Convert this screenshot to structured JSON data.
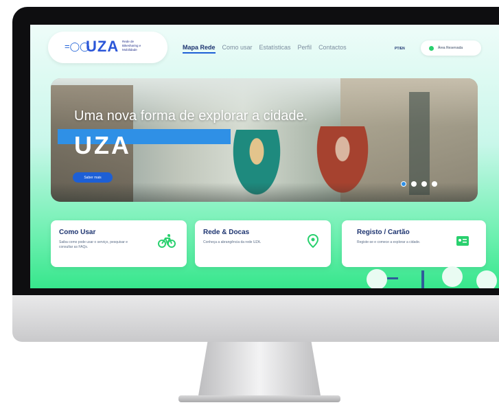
{
  "header": {
    "logo_text": "UZA",
    "logo_subtitle": "Rede de Bikesharing e Mobilidade",
    "nav": [
      {
        "label": "Mapa Rede",
        "active": true
      },
      {
        "label": "Como usar",
        "active": false
      },
      {
        "label": "Estatísticas",
        "active": false
      },
      {
        "label": "Perfil",
        "active": false
      },
      {
        "label": "Contactos",
        "active": false
      }
    ],
    "language": "PT/EN",
    "reserved_area": "Área Reservada"
  },
  "hero": {
    "title": "Uma nova forma de explorar a cidade.",
    "brand": "UZA",
    "button": "Saber mais",
    "slides": 4,
    "active_slide": 1
  },
  "cards": [
    {
      "title": "Como Usar",
      "description": "Saiba como pode usar o serviço, pesquisar e consultar as FAQs.",
      "icon": "bicycle-icon"
    },
    {
      "title": "Rede & Docas",
      "description": "Conheça a abrangência da rede UZA.",
      "icon": "map-pin-icon"
    },
    {
      "title": "Registo / Cartão",
      "description": "Registe-se e comece a explorar a cidade.",
      "icon": "id-card-icon"
    }
  ],
  "colors": {
    "accent_blue": "#1d5fd6",
    "accent_green": "#29d06e",
    "navy": "#1d3470"
  }
}
